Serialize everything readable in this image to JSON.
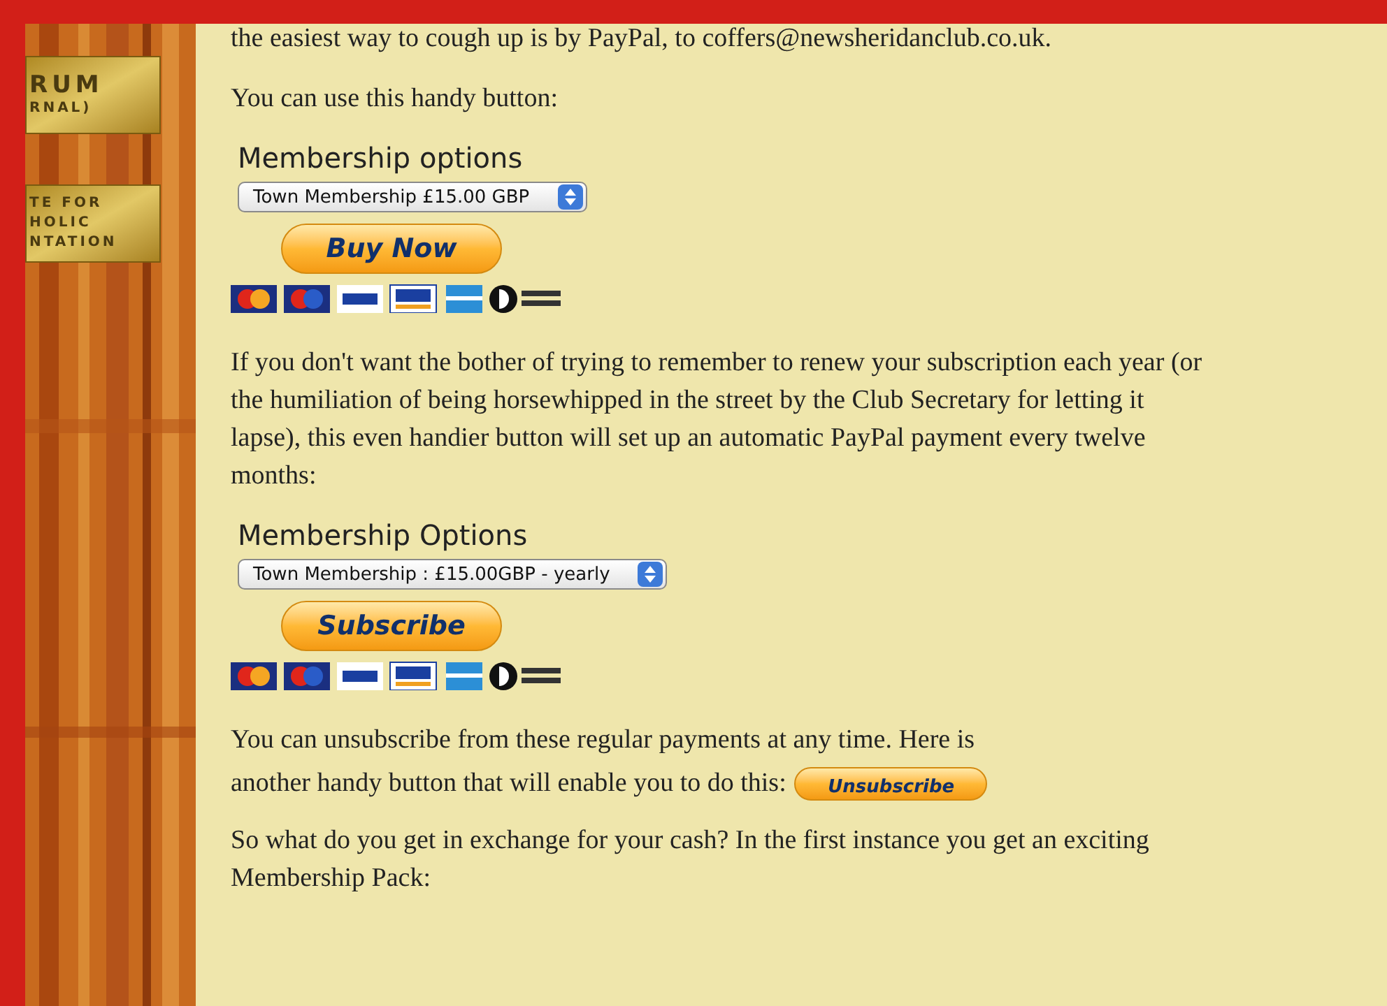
{
  "sidebar": {
    "plaques": [
      {
        "lines": [
          "RUM",
          "RNAL)"
        ]
      },
      {
        "lines": [
          "TE FOR",
          "HOLIC",
          "NTATION"
        ]
      }
    ]
  },
  "content": [
    {
      "kind": "paragraph",
      "text": "the easiest way to cough up is by PayPal, to coffers@newsheridanclub.co.uk."
    },
    {
      "kind": "paragraph",
      "text": "You can use this handy button:"
    },
    {
      "kind": "form",
      "title": "Membership options",
      "select": "Town Membership £15.00 GBP",
      "button": "Buy Now"
    },
    {
      "kind": "paragraph",
      "text": "If you don't want the bother of trying to remember to renew your subscription each year (or the humiliation of being horsewhipped in the street by the Club Secretary for letting it lapse), this even handier button will set up an automatic PayPal payment every twelve months:"
    },
    {
      "kind": "form",
      "title": "Membership Options",
      "select": "Town Membership : £15.00GBP - yearly",
      "button": "Subscribe"
    },
    {
      "kind": "paragraph_button",
      "lines": [
        "You can unsubscribe from these regular payments at any time. Here is",
        "another handy button that will enable you to do this:"
      ],
      "button": "Unsubscribe"
    },
    {
      "kind": "paragraph",
      "text": "So what do you get in exchange for your cash? In the first instance you get an exciting Membership Pack:"
    }
  ]
}
